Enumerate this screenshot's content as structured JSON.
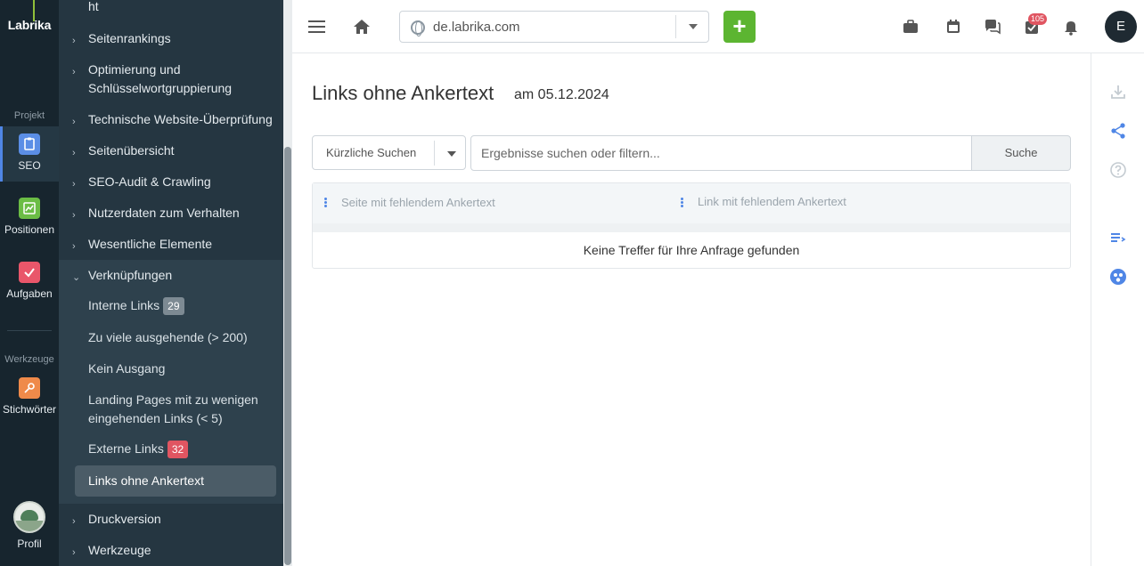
{
  "rail": {
    "logo": "Labrika",
    "project_label": "Projekt",
    "tools_label": "Werkzeuge",
    "items": [
      {
        "label": "SEO",
        "color": "#5b8ee6"
      },
      {
        "label": "Positionen",
        "color": "#6bbd45"
      },
      {
        "label": "Aufgaben",
        "color": "#e9566a"
      },
      {
        "label": "Stichwörter",
        "color": "#ef8a4a"
      }
    ],
    "profile_label": "Profil"
  },
  "nav": {
    "truncated_top": "ht",
    "items": [
      "Seitenrankings",
      "Optimierung und Schlüsselwortgruppierung",
      "Technische Website-Überprüfung",
      "Seitenübersicht",
      "SEO-Audit & Crawling",
      "Nutzerdaten zum Verhalten",
      "Wesentliche Elemente",
      "Verknüpfungen"
    ],
    "sub_items": [
      {
        "label": "Interne Links",
        "badge": "29"
      },
      {
        "label": "Zu viele ausgehende (> 200)"
      },
      {
        "label": "Kein Ausgang"
      },
      {
        "label": "Landing Pages mit zu wenigen eingehenden Links (< 5)"
      },
      {
        "label": "Externe Links",
        "badge": "32"
      },
      {
        "label": "Links ohne Ankertext"
      }
    ],
    "bottom_items": [
      "Druckversion",
      "Werkzeuge"
    ]
  },
  "topbar": {
    "domain": "de.labrika.com",
    "notification_count": "105",
    "user_initial": "E"
  },
  "main": {
    "title": "Links ohne Ankertext",
    "date": "am 05.12.2024",
    "recent_searches": "Kürzliche Suchen",
    "search_placeholder": "Ergebnisse suchen oder filtern...",
    "search_button": "Suche",
    "columns": [
      "Seite mit fehlendem Ankertext",
      "Link mit fehlendem Ankertext"
    ],
    "empty_message": "Keine Treffer für Ihre Anfrage gefunden"
  },
  "colors": {
    "accent": "#4f86e6",
    "add_button": "#5cb531",
    "badge_red": "#e05561"
  }
}
